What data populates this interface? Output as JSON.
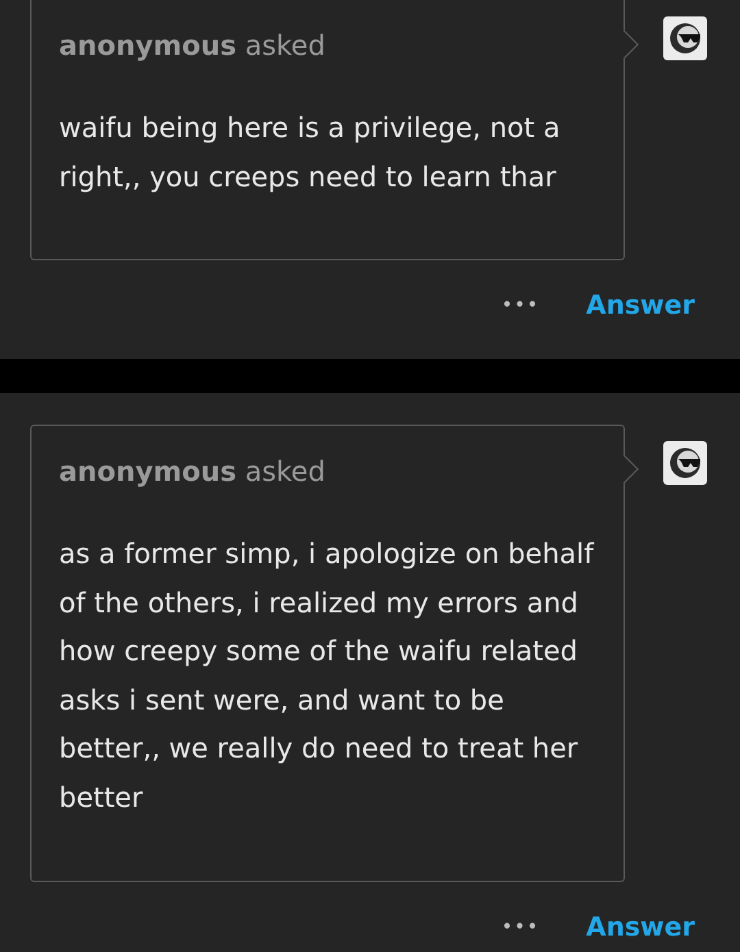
{
  "posts": [
    {
      "asker": "anonymous",
      "verb": "asked",
      "question": "waifu being here is a privilege, not a right,, you creeps need to learn thar",
      "more": "•••",
      "action": "Answer"
    },
    {
      "asker": "anonymous",
      "verb": "asked",
      "question": "as a former simp, i apologize on behalf of the others, i realized my errors and how creepy some of the waifu related asks i sent were, and want to be better,, we really do need to treat her better",
      "more": "•••",
      "action": "Answer"
    }
  ]
}
